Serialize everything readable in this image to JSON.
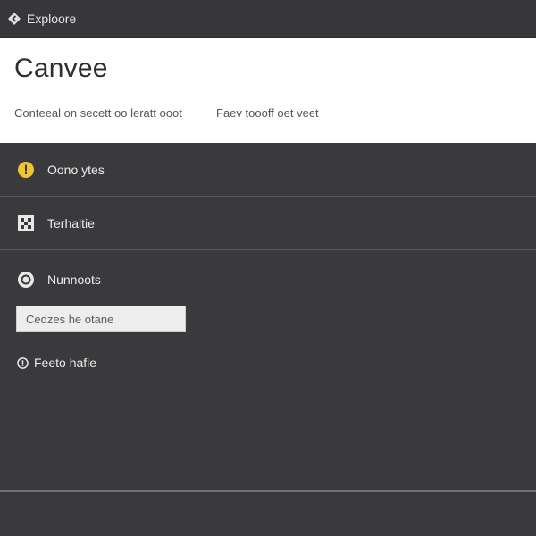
{
  "topbar": {
    "title": "Exploore",
    "icon": "diamond-icon"
  },
  "header": {
    "heading": "Canvee",
    "subtitle_left": "Conteeal on secett oo leratt ooot",
    "subtitle_right": "Faev toooff oet veet"
  },
  "list": {
    "items": [
      {
        "label": "Oono ytes",
        "icon": "warning-dot-icon",
        "icon_color": "#f2c230"
      },
      {
        "label": "Terhaltie",
        "icon": "grid-square-icon"
      }
    ]
  },
  "section": {
    "item_label": "Nunnoots",
    "item_icon": "target-circle-icon",
    "input_placeholder": "Cedzes he otane",
    "footer_link_label": "Feeto hafie",
    "footer_link_icon": "info-circle-icon"
  },
  "colors": {
    "background": "#3a3a3d",
    "header_bg": "#ffffff",
    "accent_yellow": "#f2c230",
    "text_light": "#ececec",
    "divider": "#58585b"
  }
}
